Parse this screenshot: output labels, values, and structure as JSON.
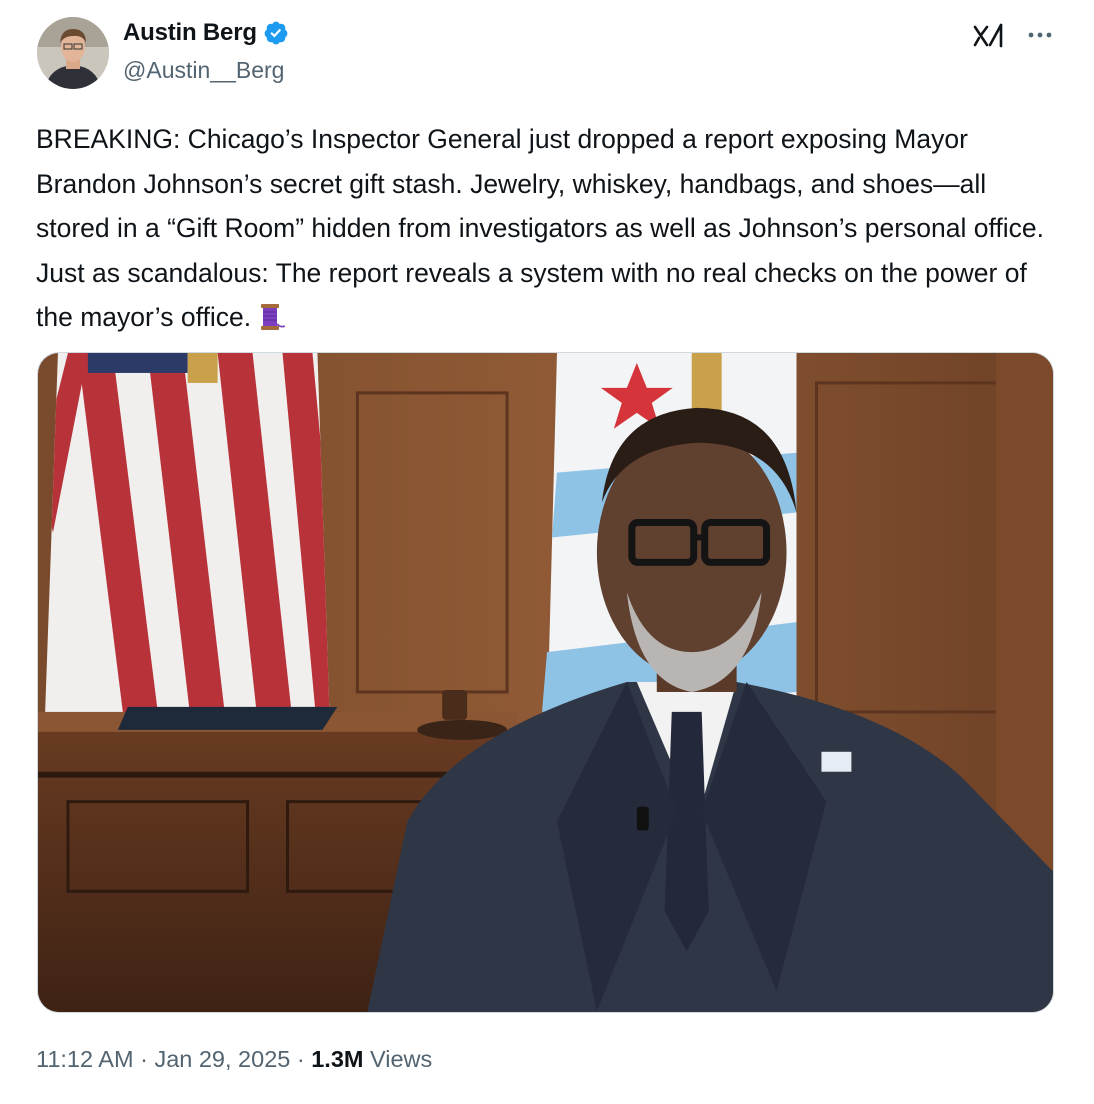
{
  "author": {
    "display_name": "Austin Berg",
    "handle": "@Austin__Berg",
    "verified": true
  },
  "icons": {
    "verified": "verified-badge-icon",
    "grok": "grok-xai-icon",
    "more": "more-options-icon",
    "emoji": "spool-of-thread-emoji"
  },
  "tweet": {
    "text": "BREAKING: Chicago’s Inspector General just dropped a report exposing Mayor Brandon Johnson’s secret gift stash. Jewelry, whiskey, handbags, and shoes—all stored in a “Gift Room” hidden from investigators as well as Johnson’s personal office. Just as scandalous: The report reveals a system with no real checks on the power of the mayor’s office."
  },
  "meta": {
    "time": "11:12 AM",
    "separator": " · ",
    "date": "Jan 29, 2025",
    "views_count": "1.3M",
    "views_label": " Views"
  },
  "colors": {
    "text": "#0f1419",
    "secondary": "#536471",
    "verified": "#1d9bf0"
  }
}
